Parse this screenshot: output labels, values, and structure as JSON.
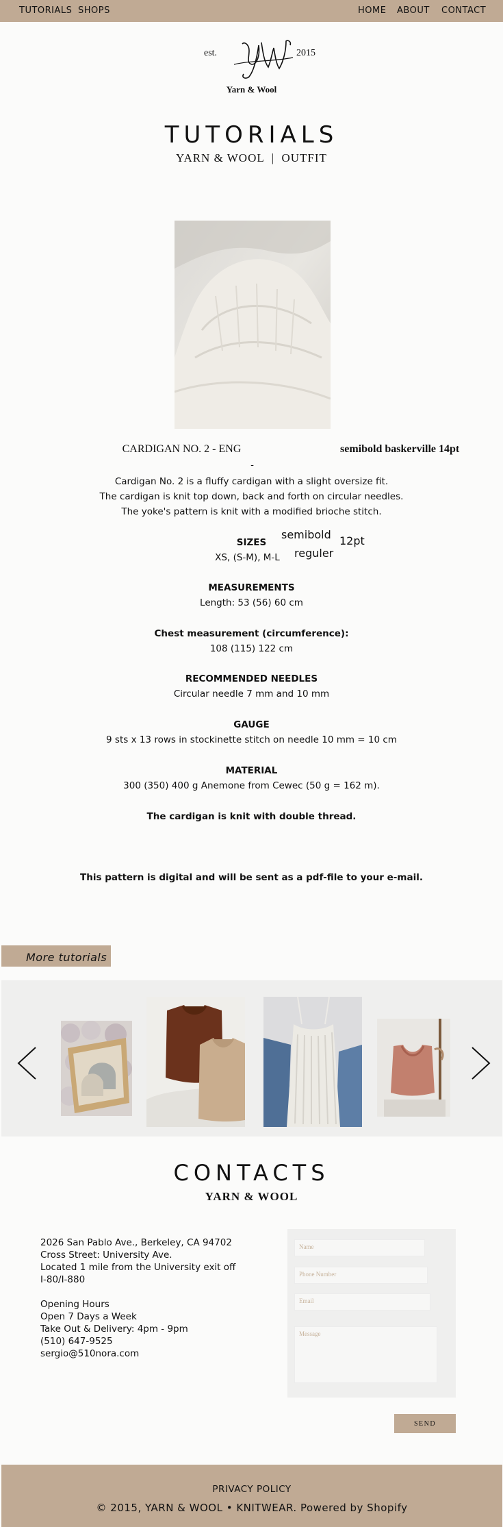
{
  "nav": {
    "left": [
      "TUTORIALS",
      "SHOPS"
    ],
    "right": [
      "HOME",
      "ABOUT",
      "CONTACT"
    ]
  },
  "logo": {
    "est": "est.",
    "year": "2015",
    "monogram": "YW",
    "brand": "Yarn & Wool"
  },
  "header": {
    "title": "TUTORIALS",
    "subtitle": "YARN & WOOL  |  OUTFIT"
  },
  "product": {
    "name": "CARDIGAN NO. 2 - ENG",
    "dash": "-",
    "description": [
      "Cardigan No. 2 is a fluffy cardigan with a slight oversize fit.",
      "The cardigan is knit top down, back and forth on circular needles.",
      "The yoke's pattern is knit with a modified brioche stitch."
    ],
    "sizes_label": "SIZES",
    "sizes_value": "XS, (S-M), M-L",
    "measurements_label": "MEASUREMENTS",
    "measurements_value": "Length: 53 (56) 60 cm",
    "chest_label": "Chest measurement (circumference):",
    "chest_value": "108 (115) 122 cm",
    "needles_label": "RECOMMENDED NEEDLES",
    "needles_value": "Circular needle 7 mm and 10 mm",
    "gauge_label": "GAUGE",
    "gauge_value": "9 sts x 13 rows in stockinette stitch on needle 10 mm = 10 cm",
    "material_label": "MATERIAL",
    "material_value": "300 (350) 400 g Anemone from Cewec (50 g = 162 m).",
    "thread_note": "The cardigan is knit with double thread.",
    "digital_note": "This pattern is digital and will be sent as a pdf-file to your e-mail."
  },
  "annotations": {
    "title_font": "semibold baskerville 14pt",
    "semibold": "semibold",
    "size": "12pt",
    "regular": "reguler"
  },
  "more_tutorials": "More tutorials",
  "carousel": {
    "prev_icon": "chevron-left-icon",
    "next_icon": "chevron-right-icon"
  },
  "contacts": {
    "title": "CONTACTS",
    "subtitle": "YARN & WOOL",
    "address": [
      "2026 San Pablo Ave., Berkeley, CA 94702",
      "Cross Street: University Ave.",
      "Located 1 mile from the University exit off",
      "I-80/I-880"
    ],
    "hours": [
      "Opening Hours",
      "Open 7 Days a Week",
      "Take Out & Delivery: 4pm - 9pm",
      "(510) 647-9525",
      "sergio@510nora.com"
    ]
  },
  "form": {
    "name_placeholder": "Name",
    "phone_placeholder": "Phone Number",
    "email_placeholder": "Email",
    "message_placeholder": "Message",
    "send_label": "SEND"
  },
  "footer": {
    "privacy": "PRIVACY POLICY",
    "copyright": "© 2015, YARN & WOOL • KNITWEAR. Powered by Shopify"
  },
  "colors": {
    "accent": "#c0aa94",
    "panel": "#efefee",
    "background": "#fbfbfa"
  }
}
